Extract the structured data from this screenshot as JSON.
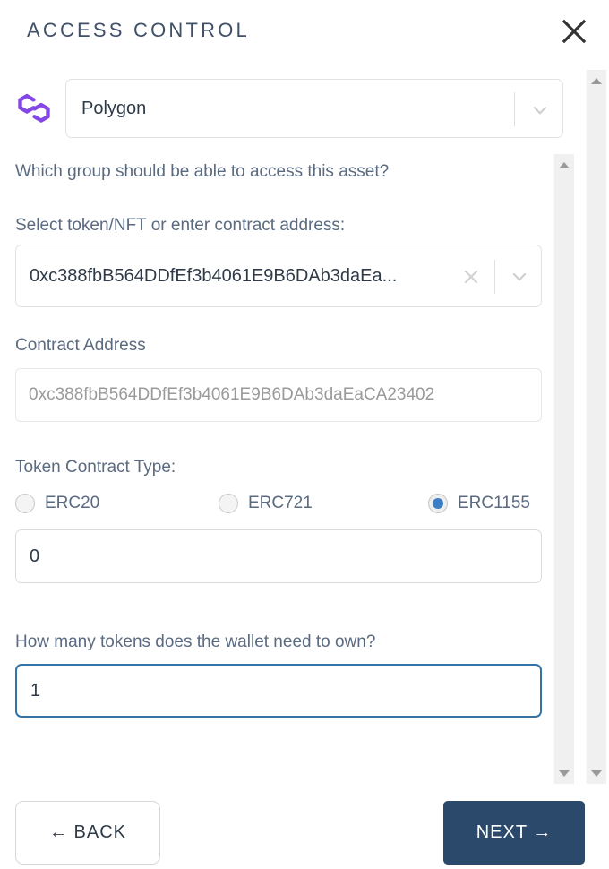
{
  "modal": {
    "title": "ACCESS CONTROL",
    "close_icon": "close-icon"
  },
  "network": {
    "logo_icon": "polygon-logo-icon",
    "selected": "Polygon",
    "chevron_icon": "chevron-down-icon",
    "accent_color": "#8247E5"
  },
  "form": {
    "group_question": "Which group should be able to access this asset?",
    "token_select_label": "Select token/NFT or enter contract address:",
    "token_select_value": "0xc388fbB564DDfEf3b4061E9B6DAb3daEa...",
    "token_select_clear_icon": "clear-x-icon",
    "token_select_chevron_icon": "chevron-down-icon",
    "contract_address_label": "Contract Address",
    "contract_address_value": "0xc388fbB564DDfEf3b4061E9B6DAb3daEaCA23402",
    "contract_address_placeholder": "0xc388fbB564DDfEf3b4061E9B6DAb3daEaCA23402",
    "token_type_label": "Token Contract Type:",
    "token_types": [
      {
        "label": "ERC20",
        "selected": false
      },
      {
        "label": "ERC721",
        "selected": false
      },
      {
        "label": "ERC1155",
        "selected": true
      }
    ],
    "token_id_value": "0",
    "amount_question": "How many tokens does the wallet need to own?",
    "amount_value": "1",
    "focus_border_color": "#3273a8",
    "radio_selected_color": "#3b7ec4"
  },
  "scrollbars": {
    "inner": {
      "up_icon": "scroll-up-arrow-icon",
      "down_icon": "scroll-down-arrow-icon"
    },
    "outer": {
      "up_icon": "scroll-up-arrow-icon",
      "down_icon": "scroll-down-arrow-icon"
    }
  },
  "footer": {
    "back_label": "←  BACK",
    "next_label": "NEXT  →",
    "next_color": "#2b4a6b"
  }
}
